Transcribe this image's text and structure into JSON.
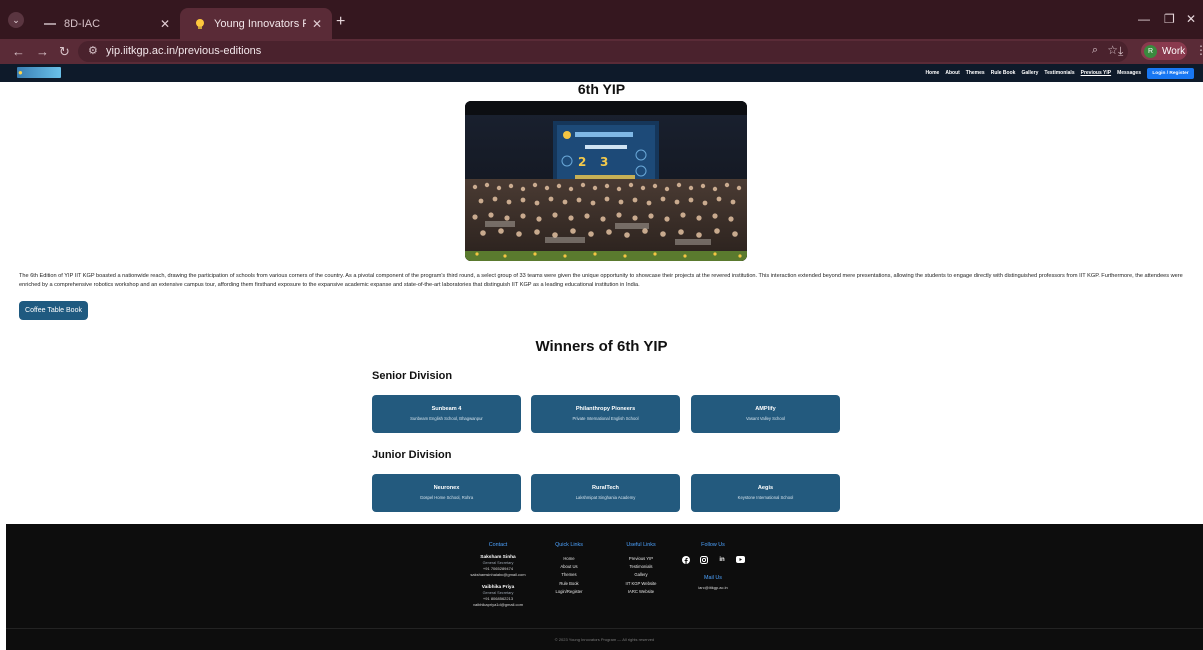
{
  "browser": {
    "tabs": [
      {
        "title": "8D-IAC",
        "active": false
      },
      {
        "title": "Young Innovators Program - Pr",
        "active": true
      }
    ],
    "url": "yip.iitkgp.ac.in/previous-editions",
    "profile_initial": "R",
    "profile_label": "Work"
  },
  "site": {
    "nav": [
      "Home",
      "About",
      "Themes",
      "Rule Book",
      "Gallery",
      "Testimonials",
      "Previous YIP",
      "Messages"
    ],
    "current_nav": "Previous YIP",
    "login_label": "Login / Register"
  },
  "main": {
    "title": "6th YIP",
    "hero_alt": "6th YIP group photo",
    "description": "The 6th Edition of YIP IIT KGP boasted a nationwide reach, drawing the participation of schools from various corners of the country. As a pivotal component of the program's third round, a select group of 33 teams were given the unique opportunity to showcase their projects at the revered institution. This interaction extended beyond mere presentations, allowing the students to engage directly with distinguished professors from IIT KGP. Furthermore, the attendees were enriched by a comprehensive robotics workshop and an extensive campus tour, affording them firsthand exposure to the expansive academic expanse and state-of-the-art laboratories that distinguish IIT KGP as a leading educational institution in India.",
    "coffee_table_book": "Coffee Table Book",
    "winners_title": "Winners of 6th YIP",
    "divisions": [
      {
        "title": "Senior Division",
        "teams": [
          {
            "name": "Sunbeam 4",
            "school": "Sunbeam English School, Bhagwanpur"
          },
          {
            "name": "Philanthropy Pioneers",
            "school": "Private International English School"
          },
          {
            "name": "AMPlify",
            "school": "Vasant Valley School"
          }
        ]
      },
      {
        "title": "Junior Division",
        "teams": [
          {
            "name": "Neuronex",
            "school": "Gospel Home School, Rohra"
          },
          {
            "name": "RuralTech",
            "school": "Lakshmipat Singhania Academy"
          },
          {
            "name": "Aegis",
            "school": "Keystone International School"
          }
        ]
      }
    ]
  },
  "footer": {
    "contact": {
      "heading": "Contact",
      "people": [
        {
          "name": "Saksham Sinha",
          "role": "General Secretary",
          "phone": "+91 7065289474",
          "email": "sakshamsinhaiabc@gmail.com"
        },
        {
          "name": "Vaibhika Priya",
          "role": "General Secretary",
          "phone": "+91 8068562213",
          "email": "vaibhikapriya1d@gmail.com"
        }
      ]
    },
    "quick_links": {
      "heading": "Quick Links",
      "items": [
        "Home",
        "About Us",
        "Themes",
        "Rule Book",
        "Login/Register"
      ]
    },
    "useful_links": {
      "heading": "Useful Links",
      "items": [
        "Previous YIP",
        "Testimonials",
        "Gallery",
        "IIT KGP Website",
        "IARC Website"
      ]
    },
    "follow": {
      "heading": "Follow Us",
      "icons": [
        "facebook-icon",
        "instagram-icon",
        "linkedin-icon",
        "youtube-icon"
      ]
    },
    "mail": {
      "heading": "Mail Us",
      "email": "iarc@iitkgp.ac.in"
    },
    "copyright": "© 2023 Young Innovators Program — All rights reserved"
  },
  "colors": {
    "card": "#235a7e",
    "button": "#1f5a80",
    "login": "#1877f2",
    "footer_heading": "#4da3ff"
  }
}
